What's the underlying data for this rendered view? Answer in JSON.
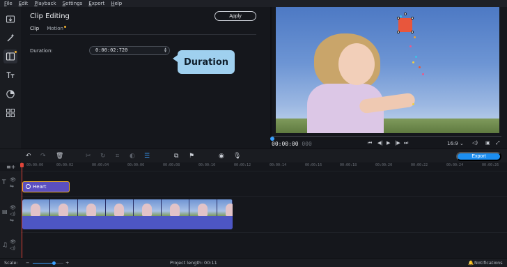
{
  "menu": [
    "File",
    "Edit",
    "Playback",
    "Settings",
    "Export",
    "Help"
  ],
  "left_tools": [
    "import-icon",
    "magic-wand-icon",
    "transitions-icon",
    "titles-icon",
    "stickers-icon",
    "more-tools-icon"
  ],
  "panel": {
    "title": "Clip Editing",
    "apply_label": "Apply",
    "tabs": [
      {
        "label": "Clip",
        "active": true
      },
      {
        "label": "Motion",
        "active": false
      }
    ],
    "duration_label": "Duration:",
    "duration_value": "0:00:02:720"
  },
  "tooltip": "Duration",
  "player": {
    "timecode_main": "00:00:00",
    "timecode_ms": "000",
    "aspect_ratio": "16:9 ⌄"
  },
  "toolbar": {
    "export_label": "Export"
  },
  "ruler_ticks": [
    "00:00:00",
    "00:00:02",
    "00:00:04",
    "00:00:06",
    "00:00:08",
    "00:00:10",
    "00:00:12",
    "00:00:14",
    "00:00:16",
    "00:00:18",
    "00:00:20",
    "00:00:22",
    "00:00:24",
    "00:00:26"
  ],
  "tracks": {
    "title_clip_label": "Heart"
  },
  "status": {
    "scale_label": "Scale:",
    "scale_level": 0.7,
    "project_length_label": "Project length:",
    "project_length_value": "00:11",
    "notifications_label": "Notifications"
  },
  "colors": {
    "accent": "#1c8ef0",
    "title_clip": "#5b4fc0",
    "video_clip": "#4b55c2",
    "tooltip": "#9fd0ef",
    "playhead": "#e0453a"
  }
}
